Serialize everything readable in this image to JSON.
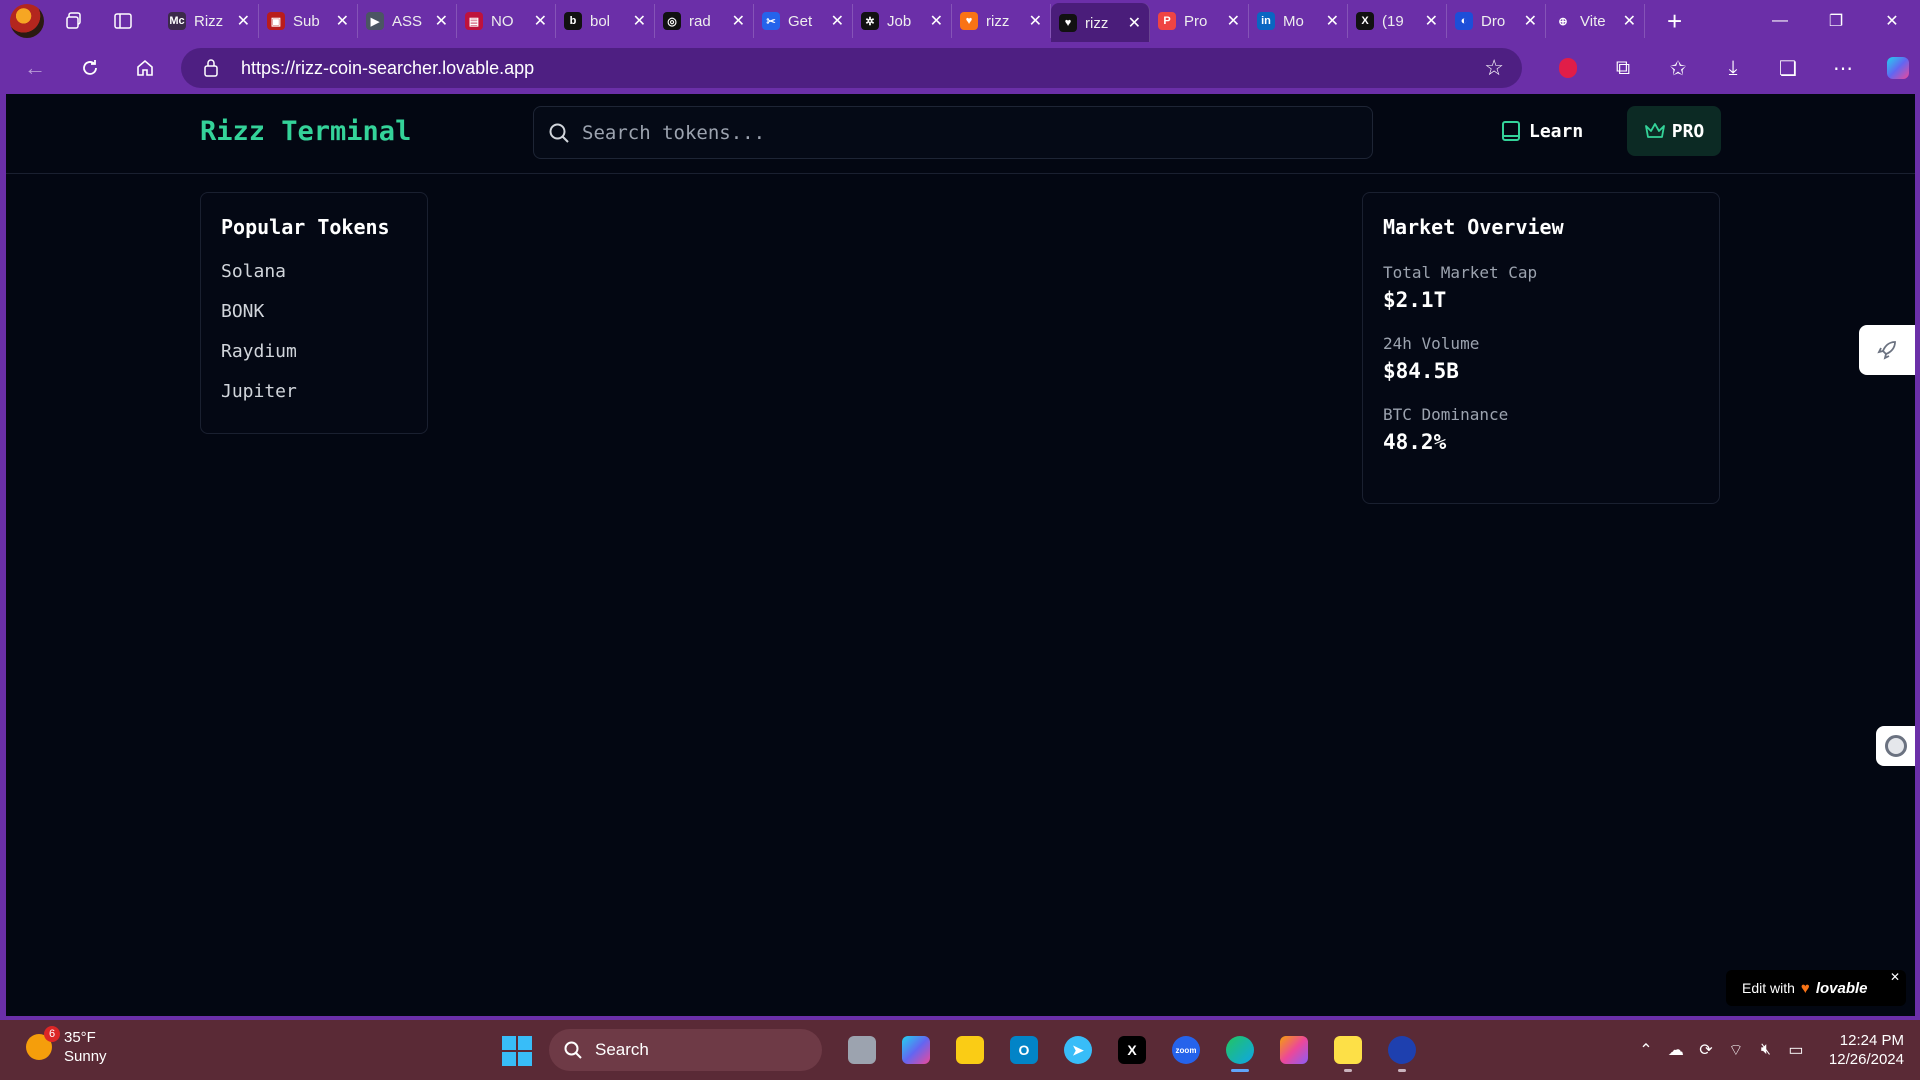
{
  "browser": {
    "tabs": [
      {
        "label": "Rizz",
        "icon": "Mc",
        "color": "#3b2a4a"
      },
      {
        "label": "Sub",
        "icon": "▣",
        "color": "#b91c1c"
      },
      {
        "label": "ASS",
        "icon": "▶",
        "color": "#4b5563"
      },
      {
        "label": "NO",
        "icon": "▤",
        "color": "#be123c"
      },
      {
        "label": "bol",
        "icon": "b",
        "color": "#111111"
      },
      {
        "label": "rad",
        "icon": "◎",
        "color": "#111111"
      },
      {
        "label": "Get",
        "icon": "✂",
        "color": "#2563eb"
      },
      {
        "label": "Job",
        "icon": "✲",
        "color": "#111111"
      },
      {
        "label": "rizz",
        "icon": "♥",
        "color": "#f97316"
      },
      {
        "label": "rizz",
        "icon": "♥",
        "color": "#111111"
      },
      {
        "label": "Pro",
        "icon": "P",
        "color": "#ef4444"
      },
      {
        "label": "Mo",
        "icon": "in",
        "color": "#0a66c2"
      },
      {
        "label": "(19",
        "icon": "X",
        "color": "#111111"
      },
      {
        "label": "Dro",
        "icon": "◐",
        "color": "#1d4ed8"
      },
      {
        "label": "Vite",
        "icon": "⊕",
        "color": "#6b2fa8"
      }
    ],
    "active_tab": 9,
    "url": "https://rizz-coin-searcher.lovable.app"
  },
  "app": {
    "logo": "Rizz Terminal",
    "search_placeholder": "Search tokens...",
    "learn_label": "Learn",
    "pro_label": "PRO",
    "accent": "#34d399"
  },
  "popular": {
    "title": "Popular Tokens",
    "items": [
      "Solana",
      "BONK",
      "Raydium",
      "Jupiter"
    ]
  },
  "market": {
    "title": "Market Overview",
    "stats": [
      {
        "label": "Total Market Cap",
        "value": "$2.1T"
      },
      {
        "label": "24h Volume",
        "value": "$84.5B"
      },
      {
        "label": "BTC Dominance",
        "value": "48.2%"
      }
    ]
  },
  "lovable": {
    "prefix": "Edit with",
    "brand": "lovable"
  },
  "taskbar": {
    "temp": "35°F",
    "condition": "Sunny",
    "weather_badge": "6",
    "search_label": "Search",
    "time": "12:24 PM",
    "date": "12/26/2024"
  }
}
